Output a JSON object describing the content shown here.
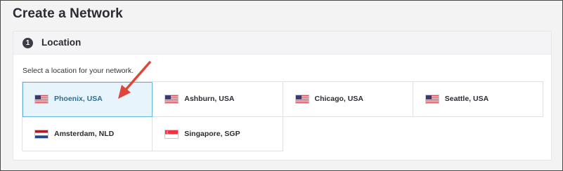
{
  "page": {
    "title": "Create a Network"
  },
  "section": {
    "step": "1",
    "title": "Location",
    "instruction": "Select a location for your network."
  },
  "locations": [
    {
      "label": "Phoenix, USA",
      "flag": "us-flag-icon",
      "selected": true
    },
    {
      "label": "Ashburn, USA",
      "flag": "us-flag-icon",
      "selected": false
    },
    {
      "label": "Chicago, USA",
      "flag": "us-flag-icon",
      "selected": false
    },
    {
      "label": "Seattle, USA",
      "flag": "us-flag-icon",
      "selected": false
    },
    {
      "label": "Amsterdam, NLD",
      "flag": "nl-flag-icon",
      "selected": false
    },
    {
      "label": "Singapore, SGP",
      "flag": "sg-flag-icon",
      "selected": false
    }
  ],
  "colors": {
    "selected_bg": "#e8f4fb",
    "selected_border": "#66b3dd",
    "selected_text": "#2a6f96",
    "annotation_arrow": "#e0453a"
  }
}
